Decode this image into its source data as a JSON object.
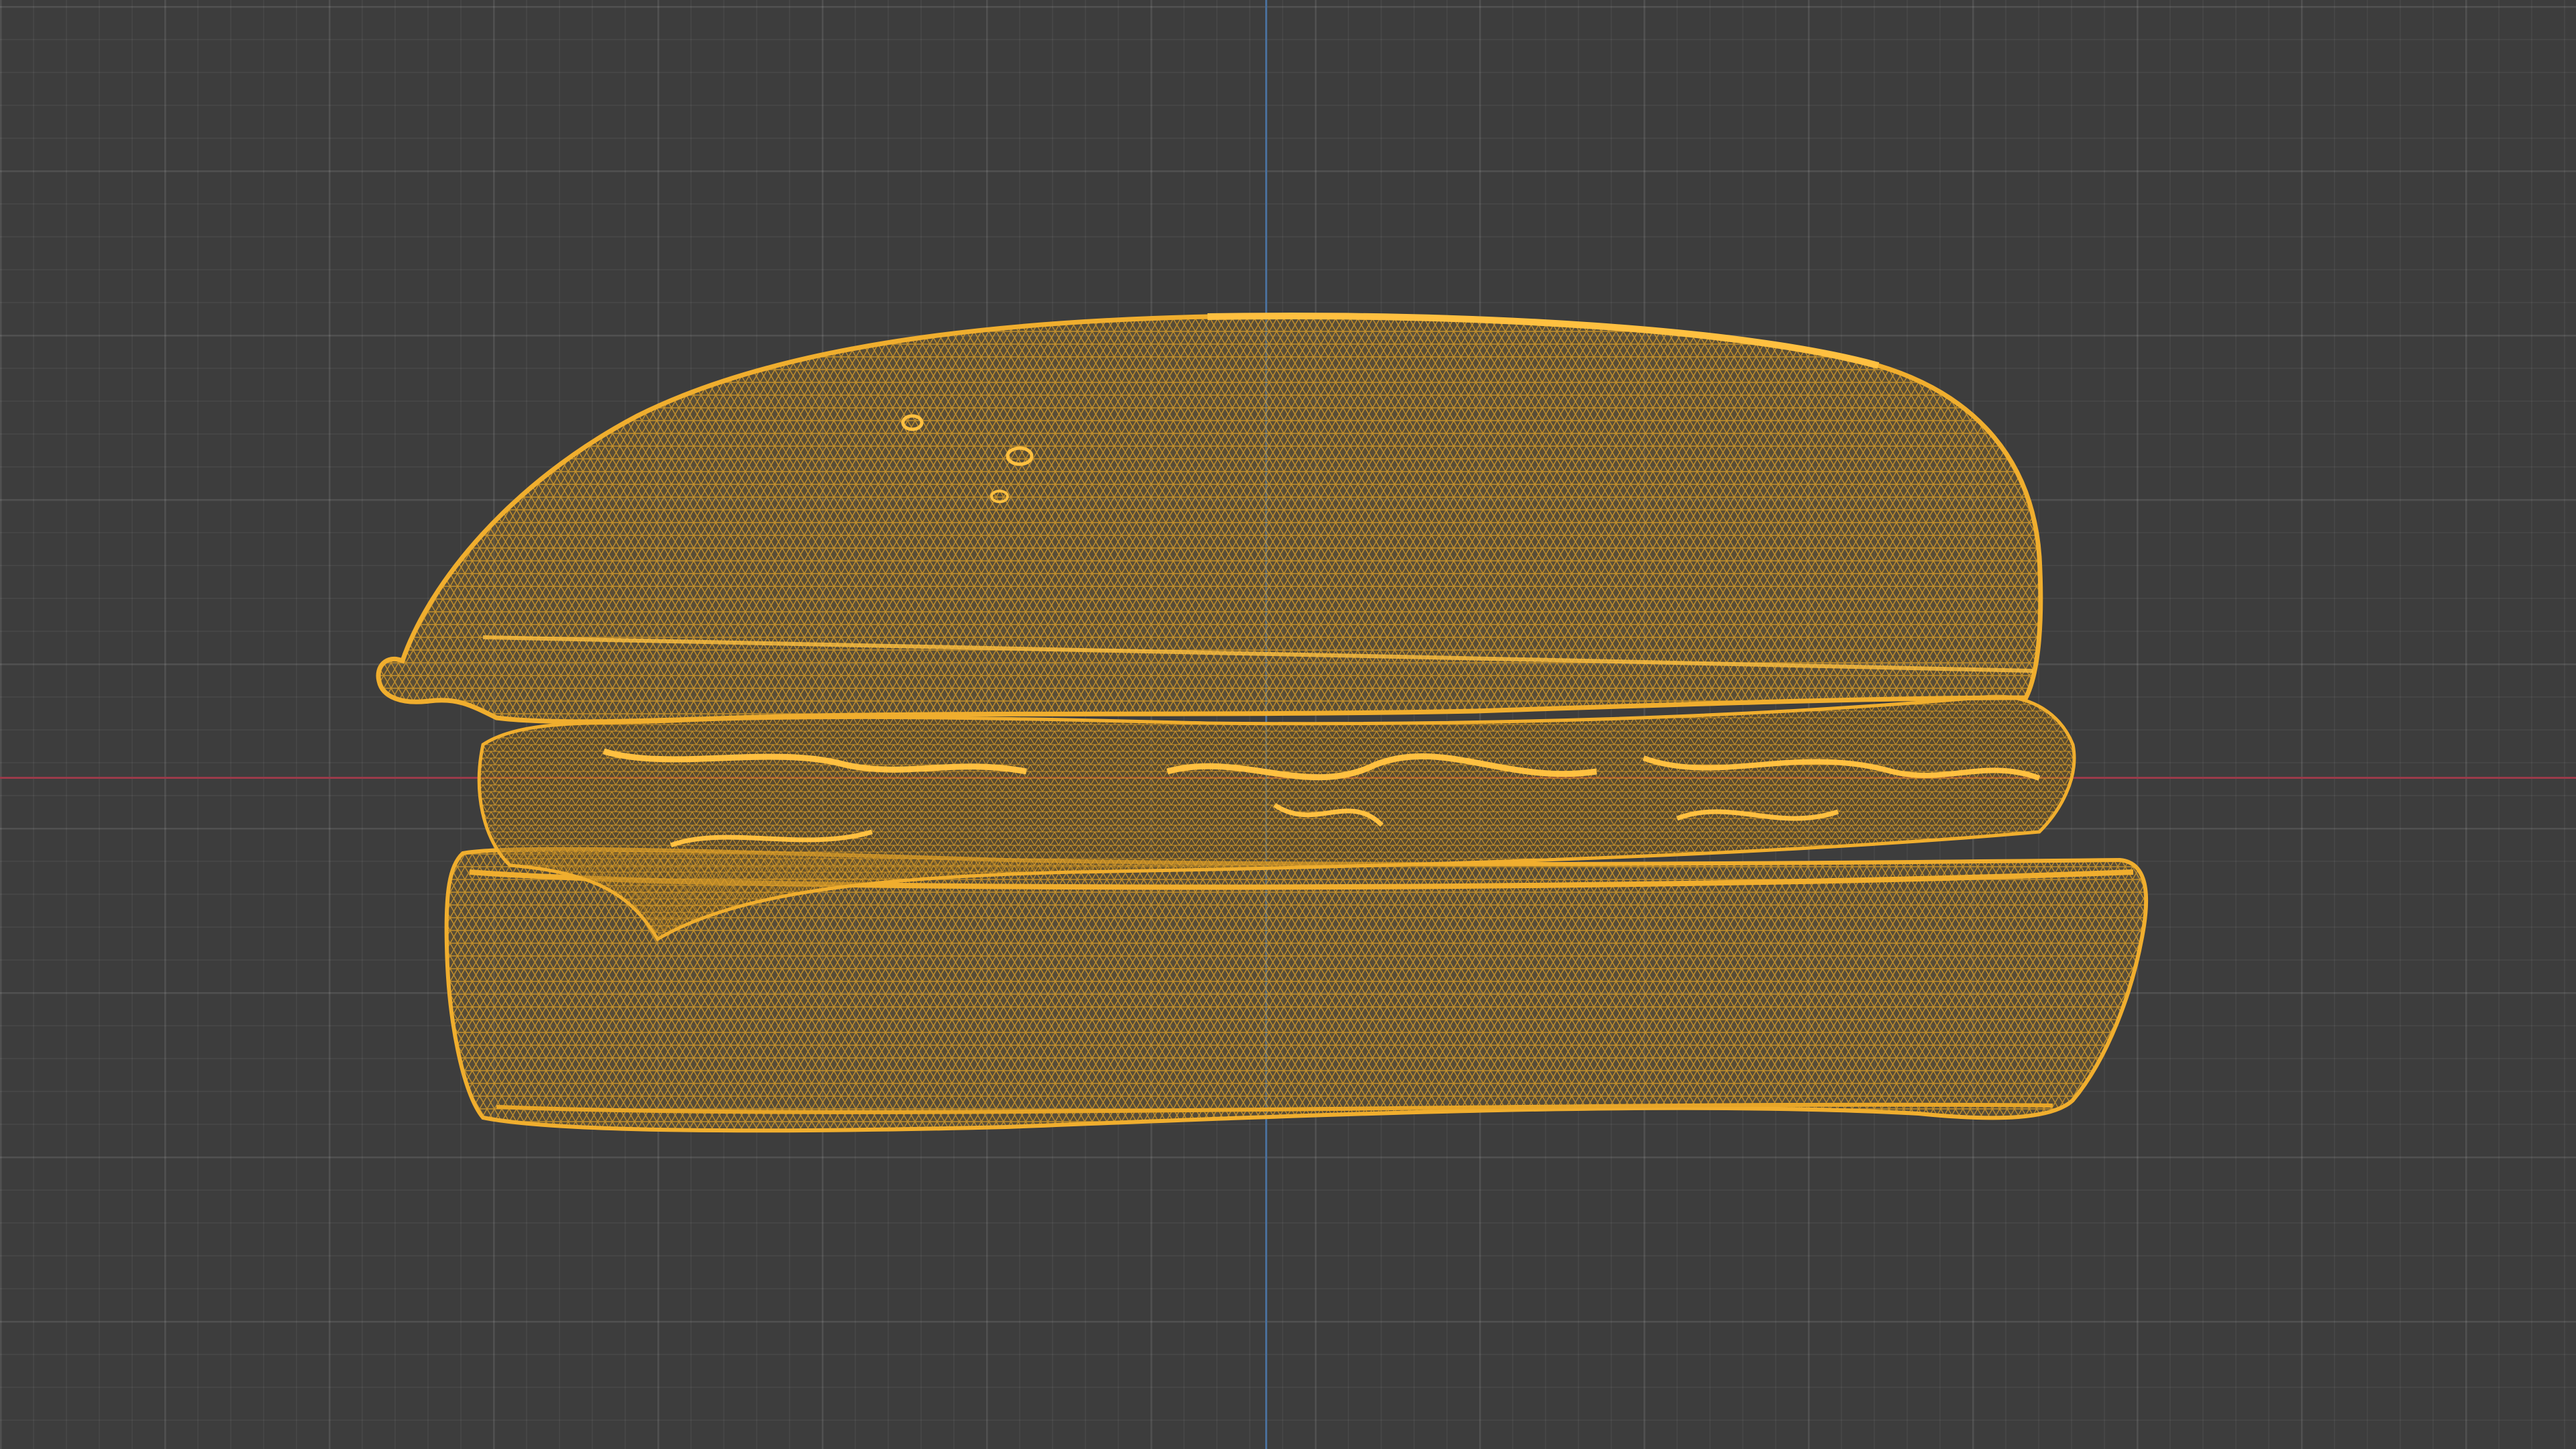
{
  "viewport": {
    "background_color": "#3d3d3d",
    "grid_color": "#4a4a4a",
    "x_axis_color": "#9b3a4a",
    "y_axis_color": "#4a6f9a"
  },
  "object": {
    "name": "burger-wireframe-mesh",
    "display_mode": "wireframe",
    "wire_color": "#e8a628",
    "selected": true
  }
}
